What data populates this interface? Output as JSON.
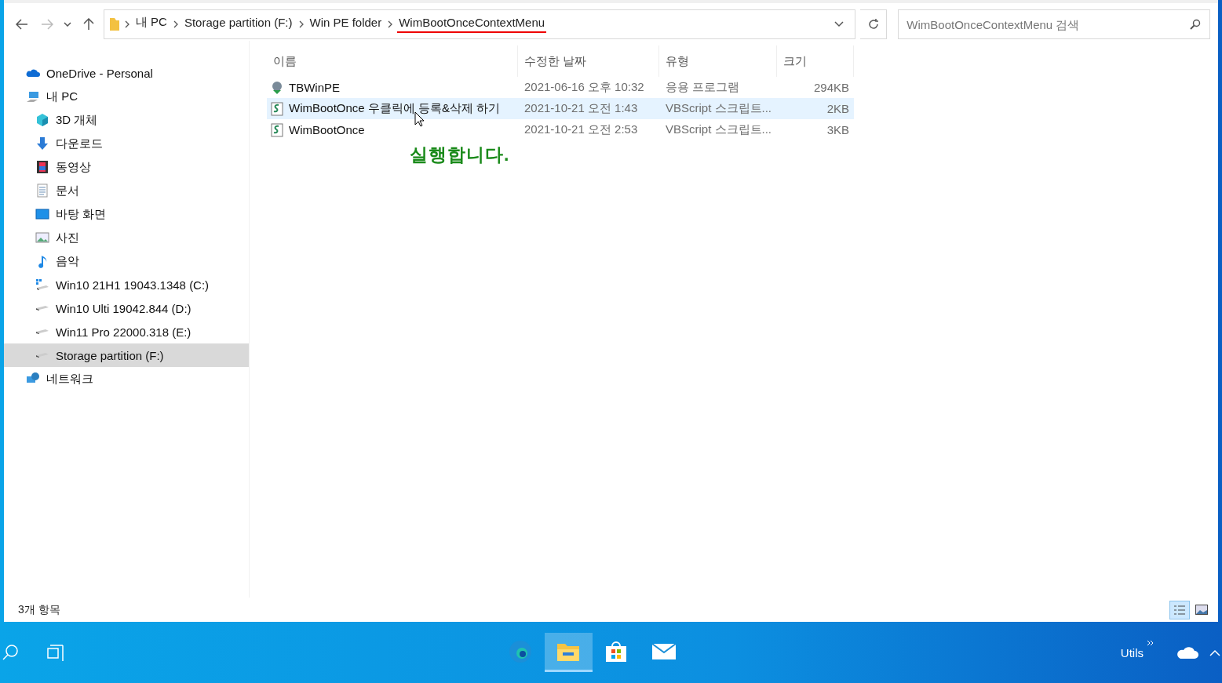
{
  "breadcrumbs": [
    {
      "label": "내 PC",
      "underlined": false
    },
    {
      "label": "Storage partition (F:)",
      "underlined": false
    },
    {
      "label": "Win PE folder",
      "underlined": false
    },
    {
      "label": "WimBootOnceContextMenu",
      "underlined": true
    }
  ],
  "search": {
    "placeholder": "WimBootOnceContextMenu 검색"
  },
  "sidebar": {
    "items": [
      {
        "label": "OneDrive - Personal",
        "kind": "cloud",
        "selected": false
      },
      {
        "label": "내 PC",
        "kind": "pc",
        "selected": false,
        "children": [
          {
            "label": "3D 개체",
            "kind": "cube",
            "selected": false
          },
          {
            "label": "다운로드",
            "kind": "download",
            "selected": false
          },
          {
            "label": "동영상",
            "kind": "film",
            "selected": false
          },
          {
            "label": "문서",
            "kind": "document",
            "selected": false
          },
          {
            "label": "바탕 화면",
            "kind": "desktop",
            "selected": false
          },
          {
            "label": "사진",
            "kind": "picture",
            "selected": false
          },
          {
            "label": "음악",
            "kind": "music",
            "selected": false
          },
          {
            "label": "Win10 21H1 19043.1348 (C:)",
            "kind": "windrive",
            "selected": false
          },
          {
            "label": "Win10 Ulti 19042.844 (D:)",
            "kind": "drive",
            "selected": false
          },
          {
            "label": "Win11 Pro 22000.318 (E:)",
            "kind": "drive",
            "selected": false
          },
          {
            "label": "Storage partition (F:)",
            "kind": "drive",
            "selected": true
          }
        ]
      },
      {
        "label": "네트워크",
        "kind": "network",
        "selected": false
      }
    ]
  },
  "table": {
    "columns": [
      "이름",
      "수정한 날짜",
      "유형",
      "크기"
    ],
    "rows": [
      {
        "kind": "app",
        "name": "TBWinPE",
        "date": "2021-06-16 오후 10:32",
        "type": "응용 프로그램",
        "size": "294KB",
        "selected": false
      },
      {
        "kind": "script",
        "name": "WimBootOnce 우클릭에 등록&삭제 하기",
        "date": "2021-10-21 오전 1:43",
        "type": "VBScript 스크립트...",
        "size": "2KB",
        "selected": true
      },
      {
        "kind": "script",
        "name": "WimBootOnce",
        "date": "2021-10-21 오전 2:53",
        "type": "VBScript 스크립트...",
        "size": "3KB",
        "selected": false
      }
    ]
  },
  "annotation": "실행합니다.",
  "status_bar": {
    "count": "3개 항목",
    "views": [
      {
        "kind": "details",
        "selected": true
      },
      {
        "kind": "thumbnails",
        "selected": false
      }
    ]
  },
  "taskbar": {
    "apps": [
      {
        "kind": "edge",
        "selected": false
      },
      {
        "kind": "explorer",
        "selected": true
      },
      {
        "kind": "store",
        "selected": false
      },
      {
        "kind": "mail",
        "selected": false
      }
    ],
    "tray_label": "Utils"
  }
}
